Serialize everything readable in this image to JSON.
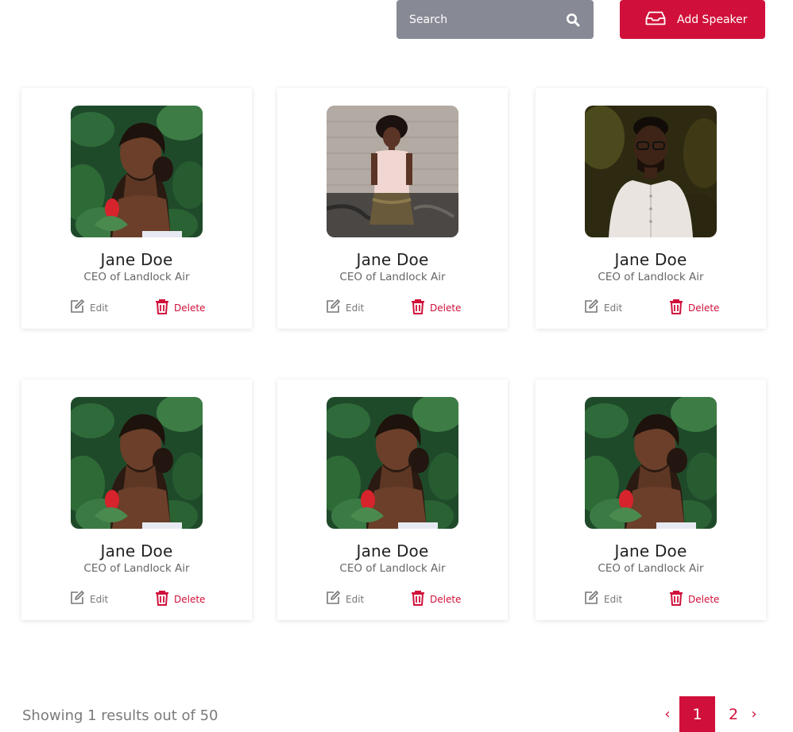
{
  "search": {
    "placeholder": "Search"
  },
  "add_button": {
    "label": "Add Speaker"
  },
  "speakers": [
    {
      "name": "Jane Doe",
      "role": "CEO of Landlock Air",
      "photo": "portrait-woman-leaves",
      "edit_label": "Edit",
      "delete_label": "Delete"
    },
    {
      "name": "Jane Doe",
      "role": "CEO of Landlock Air",
      "photo": "portrait-woman-graffiti-wall",
      "edit_label": "Edit",
      "delete_label": "Delete"
    },
    {
      "name": "Jane Doe",
      "role": "CEO of Landlock Air",
      "photo": "portrait-man-glasses",
      "edit_label": "Edit",
      "delete_label": "Delete"
    },
    {
      "name": "Jane Doe",
      "role": "CEO of Landlock Air",
      "photo": "portrait-woman-leaves",
      "edit_label": "Edit",
      "delete_label": "Delete"
    },
    {
      "name": "Jane Doe",
      "role": "CEO of Landlock Air",
      "photo": "portrait-woman-leaves",
      "edit_label": "Edit",
      "delete_label": "Delete"
    },
    {
      "name": "Jane Doe",
      "role": "CEO of Landlock Air",
      "photo": "portrait-woman-leaves",
      "edit_label": "Edit",
      "delete_label": "Delete"
    }
  ],
  "footer": {
    "showing_text": "Showing 1 results out of 50"
  },
  "pagination": {
    "prev": "‹",
    "current": "1",
    "next_page": "2",
    "next": "›"
  },
  "colors": {
    "accent": "#d0103a",
    "search_bg": "#878a94",
    "muted_text": "#777777"
  }
}
